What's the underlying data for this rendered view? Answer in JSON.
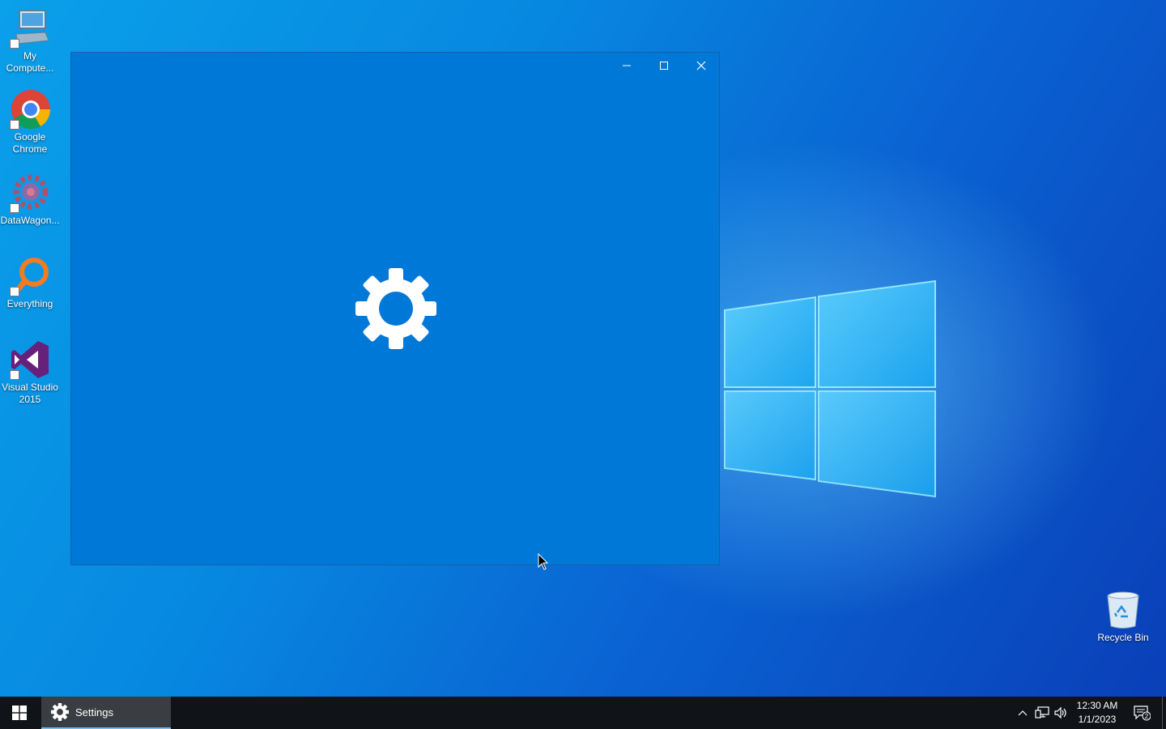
{
  "desktop": {
    "icons": [
      {
        "label": "My Compute...",
        "icon": "computer-icon"
      },
      {
        "label": "Google Chrome",
        "icon": "chrome-icon"
      },
      {
        "label": "DataWagon...",
        "icon": "datawagon-icon"
      },
      {
        "label": "Everything",
        "icon": "everything-search-icon"
      },
      {
        "label": "Visual Studio 2015",
        "icon": "visual-studio-icon"
      }
    ],
    "recycle_bin": {
      "label": "Recycle Bin",
      "icon": "recycle-bin-icon"
    }
  },
  "window": {
    "title": "",
    "splash_icon": "gear-icon",
    "background": "#0078d7",
    "controls": {
      "minimize": "minimize-icon",
      "maximize": "maximize-icon",
      "close": "close-icon"
    }
  },
  "taskbar": {
    "start_icon": "windows-start-icon",
    "active_app": {
      "label": "Settings",
      "icon": "gear-icon"
    },
    "tray": {
      "chevron": "chevron-up-icon",
      "network": "network-icon",
      "volume": "volume-icon",
      "time": "12:30 AM",
      "date": "1/1/2023",
      "notifications_count": "2"
    }
  }
}
